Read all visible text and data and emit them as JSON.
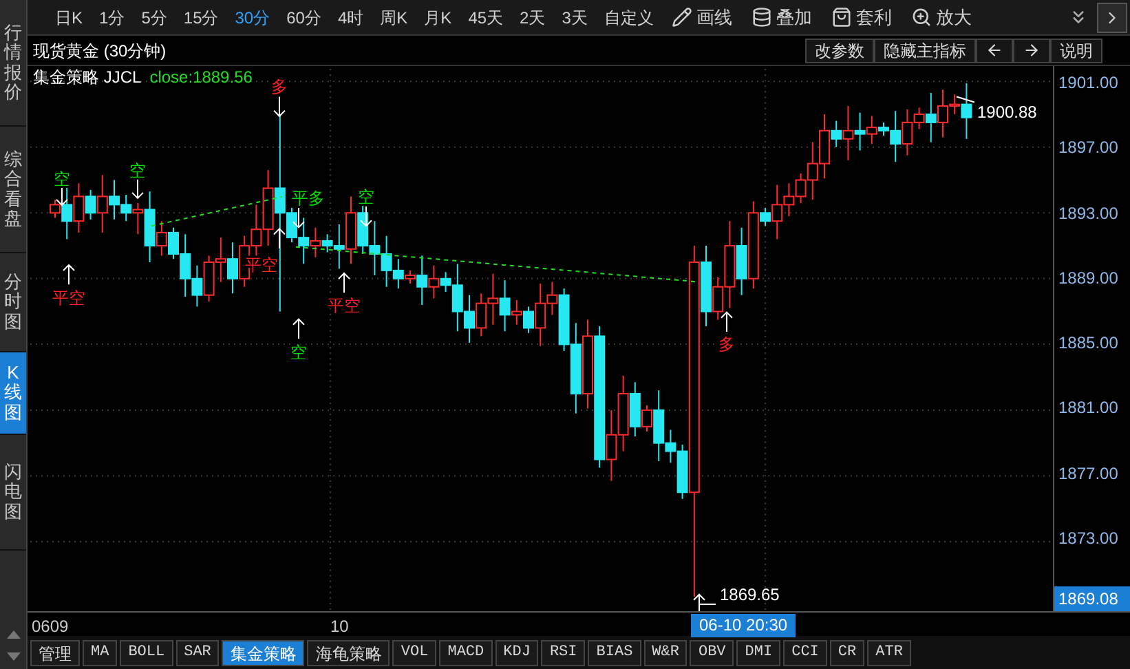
{
  "sidebar": {
    "items": [
      {
        "label": "行情报价",
        "selected": false
      },
      {
        "label": "综合看盘",
        "selected": false
      },
      {
        "label": "分时图",
        "selected": false
      },
      {
        "label": "K线图",
        "selected": true
      },
      {
        "label": "闪电图",
        "selected": false
      }
    ]
  },
  "periods": [
    {
      "label": "日K",
      "selected": false
    },
    {
      "label": "1分",
      "selected": false
    },
    {
      "label": "5分",
      "selected": false
    },
    {
      "label": "15分",
      "selected": false
    },
    {
      "label": "30分",
      "selected": true
    },
    {
      "label": "60分",
      "selected": false
    },
    {
      "label": "4时",
      "selected": false
    },
    {
      "label": "周K",
      "selected": false
    },
    {
      "label": "月K",
      "selected": false
    },
    {
      "label": "45天",
      "selected": false
    },
    {
      "label": "2天",
      "selected": false
    },
    {
      "label": "3天",
      "selected": false
    },
    {
      "label": "自定义",
      "selected": false
    }
  ],
  "tools": [
    {
      "label": "画线",
      "kind": "pencil"
    },
    {
      "label": "叠加",
      "kind": "stack"
    },
    {
      "label": "套利",
      "kind": "bag"
    },
    {
      "label": "放大",
      "kind": "zoom"
    }
  ],
  "chart_title": "现货黄金 (30分钟)",
  "chart_buttons": [
    {
      "label": "改参数",
      "kind": "text"
    },
    {
      "label": "隐藏主指标",
      "kind": "text"
    },
    {
      "kind": "left"
    },
    {
      "kind": "right"
    },
    {
      "label": "说明",
      "kind": "text"
    }
  ],
  "legend": {
    "name": "集金策略 JJCL",
    "value": "close:1889.56"
  },
  "signals": [
    {
      "label": "空",
      "color": "#00dd00",
      "kind": "above"
    },
    {
      "label": "平空",
      "color": "#ff2020",
      "kind": "below"
    },
    {
      "label": "空",
      "color": "#00dd00",
      "kind": "above"
    },
    {
      "label": "多",
      "color": "#ff2020",
      "kind": "above"
    },
    {
      "label": "平多",
      "color": "#00dd00",
      "kind": "above"
    },
    {
      "label": "平空",
      "color": "#ff2020",
      "kind": "below"
    },
    {
      "label": "空",
      "color": "#00dd00",
      "kind": "below"
    },
    {
      "label": "平空",
      "color": "#ff2020",
      "kind": "below"
    },
    {
      "label": "空",
      "color": "#00dd00",
      "kind": "above"
    },
    {
      "label": "多",
      "color": "#ff2020",
      "kind": "below"
    }
  ],
  "high_label": "1900.88",
  "low_label": "1869.65",
  "time_axis": [
    "0609",
    "10"
  ],
  "chart_data": {
    "type": "candlestick",
    "grid": true,
    "ylim": [
      1868.77,
      1901.93
    ],
    "yticks": [
      {
        "value": 1901,
        "label": "1901.00"
      },
      {
        "value": 1897,
        "label": "1897.00"
      },
      {
        "value": 1893,
        "label": "1893.00"
      },
      {
        "value": 1889,
        "label": "1889.00"
      },
      {
        "value": 1885,
        "label": "1885.00"
      },
      {
        "value": 1881,
        "label": "1881.00"
      },
      {
        "value": 1877,
        "label": "1877.00"
      },
      {
        "value": 1873,
        "label": "1873.00"
      }
    ],
    "ohlc": [
      [
        1893,
        1893.8,
        1892.7,
        1893.5
      ],
      [
        1893.5,
        1894.7,
        1891.4,
        1892.5
      ],
      [
        1892.5,
        1894.8,
        1891.8,
        1894
      ],
      [
        1894,
        1894.4,
        1892.6,
        1893
      ],
      [
        1893,
        1895.3,
        1891.8,
        1894
      ],
      [
        1894,
        1895,
        1892.6,
        1893.5
      ],
      [
        1893.5,
        1894.1,
        1892.5,
        1893
      ],
      [
        1893,
        1893.6,
        1891.7,
        1893.2
      ],
      [
        1893.2,
        1894.3,
        1890,
        1891
      ],
      [
        1891,
        1892.5,
        1890.4,
        1891.8
      ],
      [
        1891.8,
        1892.1,
        1890.2,
        1890.5
      ],
      [
        1890.5,
        1891.7,
        1887.9,
        1889
      ],
      [
        1889,
        1889.8,
        1887.3,
        1888
      ],
      [
        1888,
        1890.4,
        1887.6,
        1890
      ],
      [
        1890,
        1891.5,
        1888.8,
        1890.2
      ],
      [
        1890.2,
        1891.2,
        1888.1,
        1889
      ],
      [
        1889,
        1891.6,
        1888.5,
        1891
      ],
      [
        1891,
        1893.5,
        1889.7,
        1892
      ],
      [
        1892,
        1895.6,
        1891,
        1894.5
      ],
      [
        1894.5,
        1899,
        1887,
        1893
      ],
      [
        1893,
        1893.3,
        1891.2,
        1891.5
      ],
      [
        1891.5,
        1892.7,
        1889.9,
        1891
      ],
      [
        1891,
        1892.1,
        1890.3,
        1891.3
      ],
      [
        1891.3,
        1891.7,
        1890.6,
        1891
      ],
      [
        1891,
        1892.3,
        1889.6,
        1890.8
      ],
      [
        1890.8,
        1894,
        1889.9,
        1893
      ],
      [
        1893,
        1893.6,
        1890.5,
        1891
      ],
      [
        1891,
        1892.5,
        1889.2,
        1890.5
      ],
      [
        1890.5,
        1891.6,
        1888.5,
        1889.5
      ],
      [
        1889.5,
        1890.2,
        1888.4,
        1889
      ],
      [
        1889,
        1889.5,
        1888.7,
        1889.2
      ],
      [
        1889.2,
        1890.4,
        1887.4,
        1888.5
      ],
      [
        1888.5,
        1889.8,
        1887.8,
        1889
      ],
      [
        1889,
        1889.4,
        1888.2,
        1888.6
      ],
      [
        1888.6,
        1889.9,
        1885.8,
        1887
      ],
      [
        1887,
        1888,
        1885.1,
        1886
      ],
      [
        1886,
        1888.1,
        1885.5,
        1887.5
      ],
      [
        1887.5,
        1889.3,
        1886.2,
        1887.8
      ],
      [
        1887.8,
        1888.9,
        1885.8,
        1886.8
      ],
      [
        1886.8,
        1887.7,
        1886.2,
        1887
      ],
      [
        1887,
        1887.3,
        1885.7,
        1886
      ],
      [
        1886,
        1888.7,
        1884.9,
        1887.5
      ],
      [
        1887.5,
        1888.8,
        1886.8,
        1888
      ],
      [
        1888,
        1888.4,
        1884.6,
        1885
      ],
      [
        1885,
        1886.3,
        1880.8,
        1882
      ],
      [
        1882,
        1886.5,
        1881.1,
        1885.5
      ],
      [
        1885.5,
        1886.1,
        1877.5,
        1878
      ],
      [
        1878,
        1881,
        1876.7,
        1879.5
      ],
      [
        1879.5,
        1883.1,
        1878.5,
        1882
      ],
      [
        1882,
        1882.7,
        1879.4,
        1880
      ],
      [
        1880,
        1881.3,
        1879.7,
        1881
      ],
      [
        1881,
        1882.2,
        1877.9,
        1879
      ],
      [
        1879,
        1879.8,
        1877.8,
        1878.5
      ],
      [
        1878.5,
        1878.9,
        1875.6,
        1876
      ],
      [
        1876,
        1891,
        1869.65,
        1890
      ],
      [
        1890,
        1891,
        1886.1,
        1887
      ],
      [
        1887,
        1889.1,
        1886.5,
        1888.5
      ],
      [
        1888.5,
        1892.5,
        1887.2,
        1891
      ],
      [
        1891,
        1892.1,
        1888,
        1889
      ],
      [
        1889,
        1893.7,
        1888.4,
        1893
      ],
      [
        1893,
        1893.3,
        1892.2,
        1892.5
      ],
      [
        1892.5,
        1894.7,
        1891.4,
        1893.5
      ],
      [
        1893.5,
        1894.8,
        1892.8,
        1894
      ],
      [
        1894,
        1895.4,
        1893.6,
        1895
      ],
      [
        1895,
        1897.3,
        1893.8,
        1896
      ],
      [
        1896,
        1899,
        1895.1,
        1898
      ],
      [
        1898,
        1898.6,
        1897,
        1897.5
      ],
      [
        1897.5,
        1899.5,
        1896.2,
        1898
      ],
      [
        1898,
        1899.1,
        1896.8,
        1897.8
      ],
      [
        1897.8,
        1898.9,
        1897.2,
        1898.2
      ],
      [
        1898.2,
        1898.5,
        1897.7,
        1898
      ],
      [
        1898,
        1899.2,
        1896.1,
        1897.2
      ],
      [
        1897.2,
        1899.3,
        1896.5,
        1898.5
      ],
      [
        1898.5,
        1899.4,
        1898.1,
        1899
      ],
      [
        1899,
        1900.3,
        1897.3,
        1898.5
      ],
      [
        1898.5,
        1900.5,
        1897.6,
        1899.5
      ],
      [
        1899.5,
        1900.2,
        1899,
        1899.6
      ],
      [
        1899.6,
        1900.88,
        1897.5,
        1898.8
      ]
    ]
  },
  "current_price": "1869.08",
  "cursor_time": "06-10 20:30",
  "indicator_tabs": [
    {
      "label": "管理",
      "selected": false
    },
    {
      "label": "MA",
      "selected": false
    },
    {
      "label": "BOLL",
      "selected": false
    },
    {
      "label": "SAR",
      "selected": false
    },
    {
      "label": "集金策略",
      "selected": true
    },
    {
      "label": "海龟策略",
      "selected": false
    },
    {
      "label": "VOL",
      "selected": false
    },
    {
      "label": "MACD",
      "selected": false
    },
    {
      "label": "KDJ",
      "selected": false
    },
    {
      "label": "RSI",
      "selected": false
    },
    {
      "label": "BIAS",
      "selected": false
    },
    {
      "label": "W&R",
      "selected": false
    },
    {
      "label": "OBV",
      "selected": false
    },
    {
      "label": "DMI",
      "selected": false
    },
    {
      "label": "CCI",
      "selected": false
    },
    {
      "label": "CR",
      "selected": false
    },
    {
      "label": "ATR",
      "selected": false
    }
  ]
}
